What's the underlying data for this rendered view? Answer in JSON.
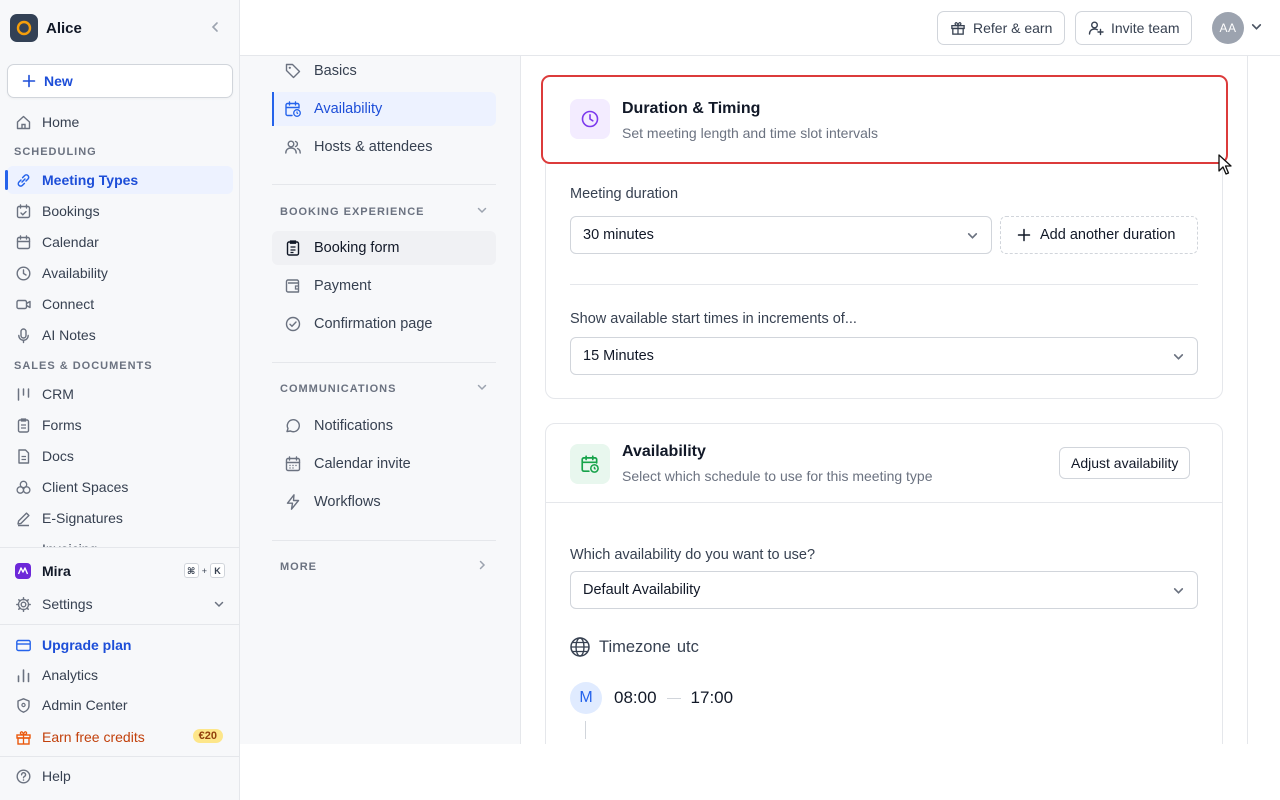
{
  "workspace": {
    "name": "Alice"
  },
  "sidebar": {
    "new_label": "New",
    "home": "Home",
    "scheduling_title": "SCHEDULING",
    "scheduling_items": [
      "Meeting Types",
      "Bookings",
      "Calendar",
      "Availability",
      "Connect",
      "AI Notes"
    ],
    "sales_title": "SALES & DOCUMENTS",
    "sales_items": [
      "CRM",
      "Forms",
      "Docs",
      "Client Spaces",
      "E-Signatures",
      "Invoicing"
    ],
    "mira": "Mira",
    "mira_shortcut": [
      "⌘",
      "+",
      "K"
    ],
    "settings": "Settings",
    "upgrade": "Upgrade plan",
    "analytics": "Analytics",
    "admin": "Admin Center",
    "earn": "Earn free credits",
    "earn_badge": "€20",
    "help": "Help"
  },
  "topbar": {
    "refer": "Refer & earn",
    "invite": "Invite team",
    "avatar_initials": "AA"
  },
  "subnav": {
    "basics": "Basics",
    "availability": "Availability",
    "hosts": "Hosts & attendees",
    "booking_exp_title": "BOOKING EXPERIENCE",
    "booking_form": "Booking form",
    "payment": "Payment",
    "confirmation": "Confirmation page",
    "communications_title": "COMMUNICATIONS",
    "notifications": "Notifications",
    "calendar_invite": "Calendar invite",
    "workflows": "Workflows",
    "more_title": "MORE"
  },
  "duration_card": {
    "title": "Duration & Timing",
    "subtitle": "Set meeting length and time slot intervals",
    "duration_label": "Meeting duration",
    "duration_value": "30 minutes",
    "add_duration": "Add another duration",
    "increments_label": "Show available start times in increments of...",
    "increments_value": "15 Minutes"
  },
  "availability_card": {
    "title": "Availability",
    "subtitle": "Select which schedule to use for this meeting type",
    "adjust_button": "Adjust availability",
    "which_label": "Which availability do you want to use?",
    "which_value": "Default Availability",
    "timezone_label": "Timezone",
    "timezone_value": "utc",
    "day_initial": "M",
    "start_time": "08:00",
    "end_time": "17:00"
  },
  "colors": {
    "accent": "#2563eb",
    "highlight": "#dc3b3b",
    "purple": "#7c3aed",
    "green": "#16a34a",
    "orange": "#c2410c"
  }
}
